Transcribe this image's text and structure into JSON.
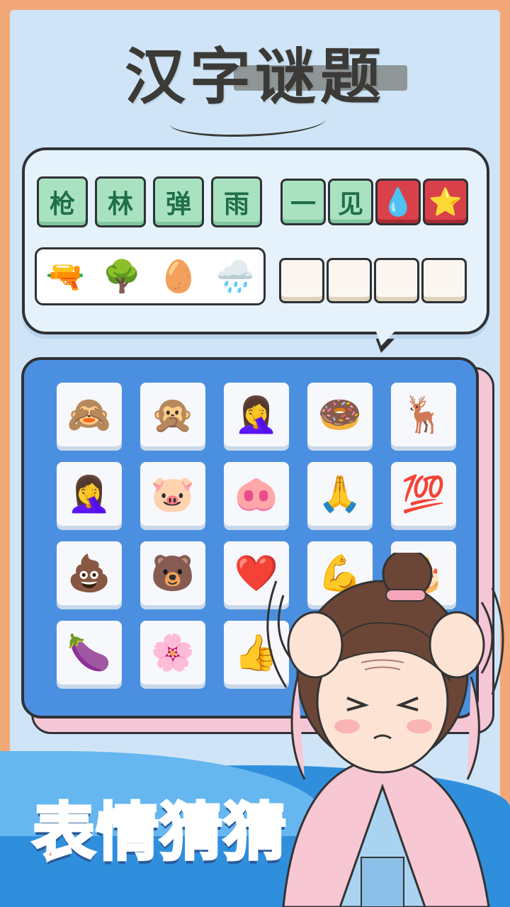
{
  "app": {
    "title": "汉字谜题"
  },
  "answer_tiles": [
    {
      "text": "枪",
      "style": "green"
    },
    {
      "text": "林",
      "style": "green"
    },
    {
      "text": "弹",
      "style": "green"
    },
    {
      "text": "雨",
      "style": "green"
    }
  ],
  "previous_tiles": [
    {
      "text": "一",
      "style": "green"
    },
    {
      "text": "见",
      "style": "green"
    },
    {
      "text": "💧",
      "style": "red"
    },
    {
      "text": "⭐",
      "style": "red"
    }
  ],
  "clue_emojis": [
    "🔫",
    "🌳",
    "🥚",
    "🌧️"
  ],
  "blank_slots": [
    "",
    "",
    "",
    ""
  ],
  "emoji_grid": [
    [
      "🙈",
      "🙊",
      "🤦‍♀️",
      "🍩",
      "🦌"
    ],
    [
      "🤦‍♀️",
      "🐷",
      "🐽",
      "🙏",
      "💯"
    ],
    [
      "💩",
      "🐻",
      "❤️",
      "💪",
      "🎂"
    ],
    [
      "🍆",
      "🌸",
      "👍",
      "",
      ""
    ]
  ],
  "banner": {
    "text": "表情猜猜"
  },
  "colors": {
    "background": "#f2a878",
    "panel": "#cfe5f7",
    "board": "#4b90e0",
    "tile_green": "#a9e2c1",
    "tile_red": "#d9414a",
    "banner_text": "#f25a2c"
  }
}
